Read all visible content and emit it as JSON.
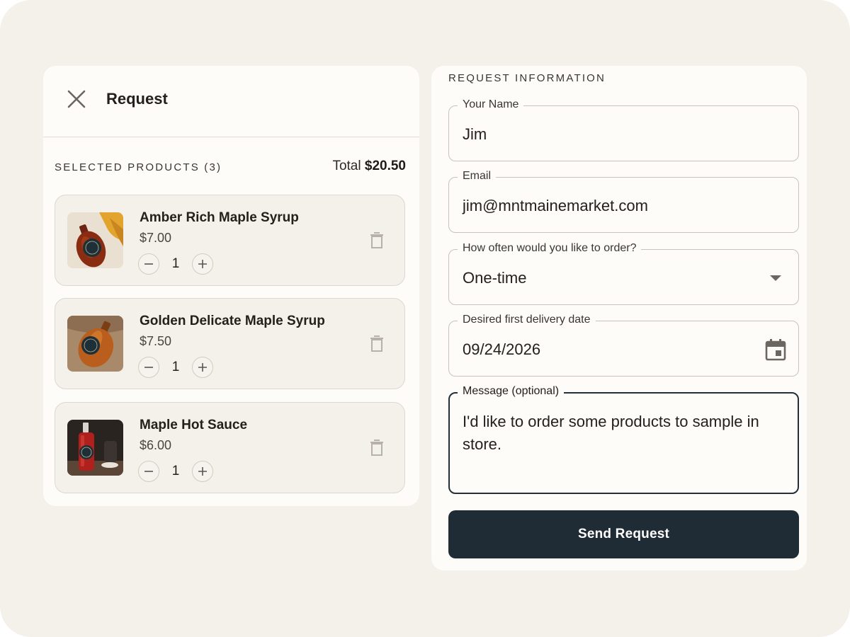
{
  "panel": {
    "title": "Request",
    "selected_label": "SELECTED PRODUCTS (3)",
    "total_prefix": "Total",
    "total_value": "$20.50"
  },
  "products": [
    {
      "name": "Amber Rich Maple Syrup",
      "price": "$7.00",
      "qty": "1"
    },
    {
      "name": "Golden Delicate Maple Syrup",
      "price": "$7.50",
      "qty": "1"
    },
    {
      "name": "Maple Hot Sauce",
      "price": "$6.00",
      "qty": "1"
    }
  ],
  "form": {
    "section_label": "REQUEST INFORMATION",
    "name": {
      "label": "Your Name",
      "value": "Jim"
    },
    "email": {
      "label": "Email",
      "value": "jim@mntmainemarket.com"
    },
    "frequency": {
      "label": "How often would you like to order?",
      "value": "One-time"
    },
    "delivery_date": {
      "label": "Desired first delivery date",
      "value": "09/24/2026"
    },
    "message": {
      "label": "Message (optional)",
      "value": "I'd like to order some products to sample in store."
    },
    "submit_label": "Send Request"
  },
  "icons": {
    "close": "close-icon",
    "minus": "minus-icon",
    "plus": "plus-icon",
    "trash": "trash-icon",
    "dropdown": "caret-down-icon",
    "calendar": "calendar-icon"
  },
  "colors": {
    "background": "#f4f0ea",
    "card": "#fdfcf9",
    "accent": "#1f2c35"
  }
}
